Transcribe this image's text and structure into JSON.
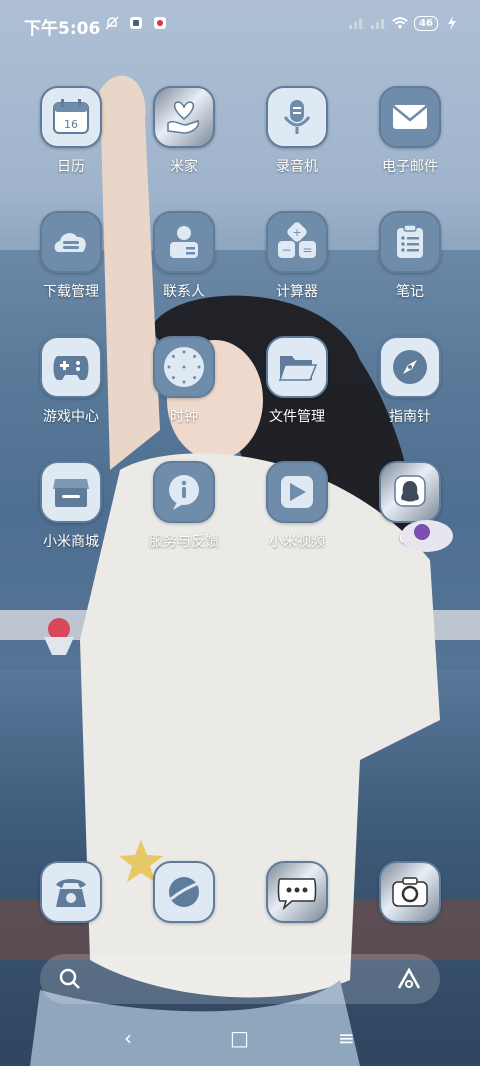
{
  "status": {
    "time": "下午5:06",
    "battery": "46",
    "icons": [
      "mute-icon",
      "app-notification-icon",
      "app-notification-icon-2",
      "signal-x-icon",
      "signal-x-icon-2",
      "wifi-icon",
      "charging-icon"
    ]
  },
  "apps": [
    {
      "id": "calendar",
      "label": "日历",
      "icon": "calendar-icon",
      "glyph": "16"
    },
    {
      "id": "mijia",
      "label": "米家",
      "icon": "hand-heart-icon"
    },
    {
      "id": "recorder",
      "label": "录音机",
      "icon": "microphone-icon"
    },
    {
      "id": "email",
      "label": "电子邮件",
      "icon": "envelope-icon"
    },
    {
      "id": "downloads",
      "label": "下载管理",
      "icon": "cloud-download-icon"
    },
    {
      "id": "contacts",
      "label": "联系人",
      "icon": "contact-card-icon"
    },
    {
      "id": "calculator",
      "label": "计算器",
      "icon": "calculator-icon"
    },
    {
      "id": "notes",
      "label": "笔记",
      "icon": "clipboard-icon"
    },
    {
      "id": "games",
      "label": "游戏中心",
      "icon": "gamepad-icon"
    },
    {
      "id": "clock",
      "label": "时钟",
      "icon": "clock-icon"
    },
    {
      "id": "files",
      "label": "文件管理",
      "icon": "folder-icon"
    },
    {
      "id": "compass",
      "label": "指南针",
      "icon": "compass-icon"
    },
    {
      "id": "mistore",
      "label": "小米商城",
      "icon": "store-icon"
    },
    {
      "id": "service",
      "label": "服务与反馈",
      "icon": "info-icon"
    },
    {
      "id": "mivideo",
      "label": "小米视频",
      "icon": "play-icon"
    },
    {
      "id": "qq",
      "label": "QQ",
      "icon": "qq-penguin-icon"
    }
  ],
  "dock": [
    {
      "id": "phone",
      "icon": "telephone-icon"
    },
    {
      "id": "browser",
      "icon": "planet-icon"
    },
    {
      "id": "messages",
      "icon": "chat-bubble-icon"
    },
    {
      "id": "camera",
      "icon": "camera-icon"
    }
  ],
  "search": {
    "icon": "search-icon",
    "assistant_icon": "assistant-a-icon"
  },
  "navbar": {
    "back": "‹",
    "home": "□",
    "menu": "≡"
  }
}
